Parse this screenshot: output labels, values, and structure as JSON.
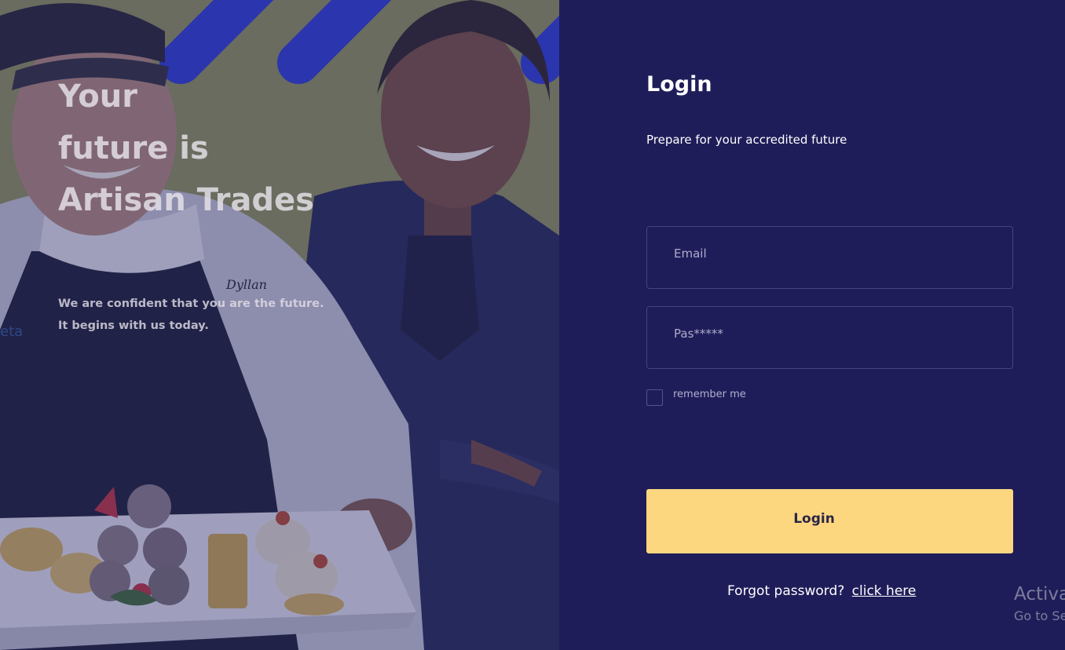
{
  "hero": {
    "title_lines": [
      "Your",
      "future is",
      "Artisan Trades"
    ],
    "subtitle_lines": [
      "We are confident that you are the future.",
      "It begins with us today."
    ],
    "photo": {
      "apron_name": "Dyllan",
      "badge_text": "eta"
    }
  },
  "login": {
    "title": "Login",
    "subtitle": "Prepare for your accredited future",
    "email_placeholder": "Email",
    "password_placeholder": "Pas*****",
    "remember_label": "remember me",
    "button_label": "Login",
    "forgot_text": "Forgot  password?",
    "forgot_link": "click here"
  },
  "watermark": {
    "line1": "Activate Windows",
    "line2": "Go to Settings to activate Windows."
  },
  "colors": {
    "panel_bg": "#1f1d59",
    "button_bg": "#fdd77f",
    "field_border": "#45437e"
  }
}
